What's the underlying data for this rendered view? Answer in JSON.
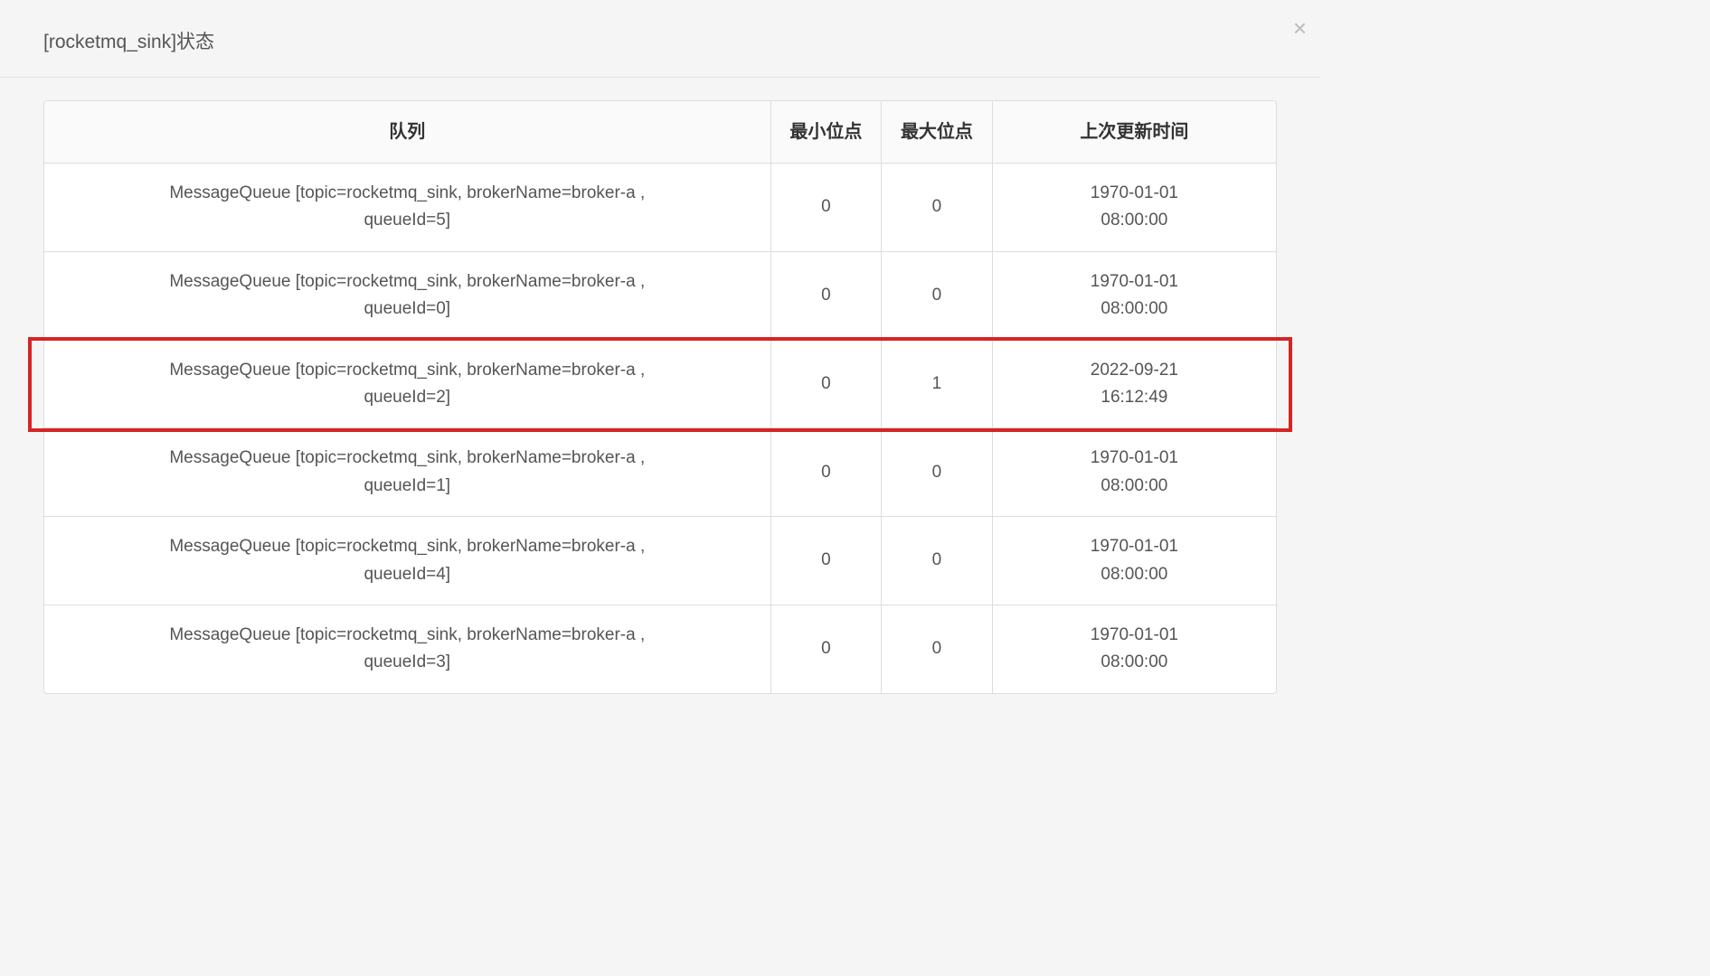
{
  "dialog": {
    "title": "[rocketmq_sink]状态",
    "close_symbol": "×"
  },
  "table": {
    "headers": {
      "queue": "队列",
      "min_offset": "最小位点",
      "max_offset": "最大位点",
      "last_update": "上次更新时间"
    },
    "rows": [
      {
        "queue": "MessageQueue [topic=rocketmq_sink, brokerName=broker-a ,\nqueueId=5]",
        "min_offset": "0",
        "max_offset": "0",
        "last_update": "1970-01-01\n08:00:00",
        "highlight": false
      },
      {
        "queue": "MessageQueue [topic=rocketmq_sink, brokerName=broker-a ,\nqueueId=0]",
        "min_offset": "0",
        "max_offset": "0",
        "last_update": "1970-01-01\n08:00:00",
        "highlight": false
      },
      {
        "queue": "MessageQueue [topic=rocketmq_sink, brokerName=broker-a ,\nqueueId=2]",
        "min_offset": "0",
        "max_offset": "1",
        "last_update": "2022-09-21\n16:12:49",
        "highlight": true
      },
      {
        "queue": "MessageQueue [topic=rocketmq_sink, brokerName=broker-a ,\nqueueId=1]",
        "min_offset": "0",
        "max_offset": "0",
        "last_update": "1970-01-01\n08:00:00",
        "highlight": false
      },
      {
        "queue": "MessageQueue [topic=rocketmq_sink, brokerName=broker-a ,\nqueueId=4]",
        "min_offset": "0",
        "max_offset": "0",
        "last_update": "1970-01-01\n08:00:00",
        "highlight": false
      },
      {
        "queue": "MessageQueue [topic=rocketmq_sink, brokerName=broker-a ,\nqueueId=3]",
        "min_offset": "0",
        "max_offset": "0",
        "last_update": "1970-01-01\n08:00:00",
        "highlight": false
      }
    ]
  }
}
